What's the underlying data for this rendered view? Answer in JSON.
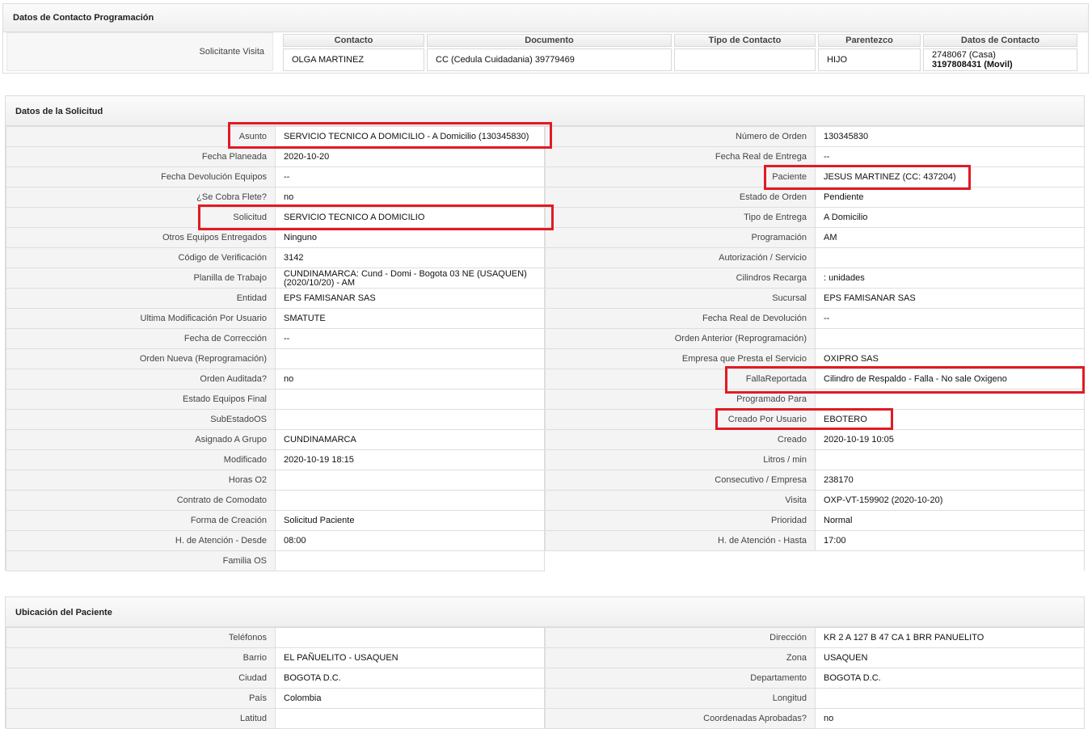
{
  "contact_section": {
    "title": "Datos de Contacto Programación",
    "row_label": "Solicitante Visita",
    "headers": [
      "Contacto",
      "Documento",
      "Tipo de Contacto",
      "Parentezco",
      "Datos de Contacto"
    ],
    "contacto": "OLGA MARTINEZ",
    "documento": "CC (Cedula Cuidadania) 39779469",
    "tipo_contacto": "",
    "parentezco": "HIJO",
    "datos_contacto_line1": "2748067 (Casa)",
    "datos_contacto_line2": "3197808431 (Movil)"
  },
  "solicitud_section": {
    "title": "Datos de la Solicitud",
    "left": [
      {
        "label": "Asunto",
        "value": "SERVICIO TECNICO A DOMICILIO - A Domicilio (130345830)"
      },
      {
        "label": "Fecha Planeada",
        "value": "2020-10-20"
      },
      {
        "label": "Fecha Devolución Equipos",
        "value": "--"
      },
      {
        "label": "¿Se Cobra Flete?",
        "value": "no"
      },
      {
        "label": "Solicitud",
        "value": "SERVICIO TECNICO A DOMICILIO"
      },
      {
        "label": "Otros Equipos Entregados",
        "value": "Ninguno"
      },
      {
        "label": "Código de Verificación",
        "value": "3142"
      },
      {
        "label": "Planilla de Trabajo",
        "value": "CUNDINAMARCA: Cund - Domi - Bogota 03 NE (USAQUEN) (2020/10/20) - AM"
      },
      {
        "label": "Entidad",
        "value": "EPS FAMISANAR SAS"
      },
      {
        "label": "Ultima Modificación Por Usuario",
        "value": "SMATUTE"
      },
      {
        "label": "Fecha de Corrección",
        "value": "--"
      },
      {
        "label": "Orden Nueva (Reprogramación)",
        "value": ""
      },
      {
        "label": "Orden Auditada?",
        "value": "no"
      },
      {
        "label": "Estado Equipos Final",
        "value": ""
      },
      {
        "label": "SubEstadoOS",
        "value": ""
      },
      {
        "label": "Asignado A Grupo",
        "value": "CUNDINAMARCA"
      },
      {
        "label": "Modificado",
        "value": "2020-10-19 18:15"
      },
      {
        "label": "Horas O2",
        "value": ""
      },
      {
        "label": "Contrato de Comodato",
        "value": ""
      },
      {
        "label": "Forma de Creación",
        "value": "Solicitud Paciente"
      },
      {
        "label": "H. de Atención - Desde",
        "value": "08:00"
      },
      {
        "label": "Familia OS",
        "value": ""
      }
    ],
    "right": [
      {
        "label": "Número de Orden",
        "value": "130345830"
      },
      {
        "label": "Fecha Real de Entrega",
        "value": "--"
      },
      {
        "label": "Paciente",
        "value": "JESUS MARTINEZ (CC: 437204)"
      },
      {
        "label": "Estado de Orden",
        "value": "Pendiente"
      },
      {
        "label": "Tipo de Entrega",
        "value": "A Domicilio"
      },
      {
        "label": "Programación",
        "value": "AM"
      },
      {
        "label": "Autorización / Servicio",
        "value": ""
      },
      {
        "label": "Cilindros Recarga",
        "value": ": unidades"
      },
      {
        "label": "Sucursal",
        "value": "EPS FAMISANAR SAS"
      },
      {
        "label": "Fecha Real de Devolución",
        "value": "--"
      },
      {
        "label": "Orden Anterior (Reprogramación)",
        "value": ""
      },
      {
        "label": "Empresa que Presta el Servicio",
        "value": "OXIPRO SAS"
      },
      {
        "label": "FallaReportada",
        "value": "Cilindro de Respaldo - Falla - No sale Oxigeno"
      },
      {
        "label": "Programado Para",
        "value": ""
      },
      {
        "label": "Creado Por Usuario",
        "value": "EBOTERO"
      },
      {
        "label": "Creado",
        "value": "2020-10-19 10:05"
      },
      {
        "label": "Litros / min",
        "value": ""
      },
      {
        "label": "Consecutivo / Empresa",
        "value": "238170"
      },
      {
        "label": "Visita",
        "value": "OXP-VT-159902 (2020-10-20)"
      },
      {
        "label": "Prioridad",
        "value": "Normal"
      },
      {
        "label": "H. de Atención - Hasta",
        "value": "17:00"
      }
    ]
  },
  "ubicacion_section": {
    "title": "Ubicación del Paciente",
    "left": [
      {
        "label": "Teléfonos",
        "value": ""
      },
      {
        "label": "Barrio",
        "value": "EL PAÑUELITO - USAQUEN"
      },
      {
        "label": "Ciudad",
        "value": "BOGOTA D.C."
      },
      {
        "label": "País",
        "value": "Colombia"
      },
      {
        "label": "Latitud",
        "value": ""
      }
    ],
    "right": [
      {
        "label": "Dirección",
        "value": "KR 2 A 127 B 47 CA 1 BRR PANUELITO"
      },
      {
        "label": "Zona",
        "value": "USAQUEN"
      },
      {
        "label": "Departamento",
        "value": "BOGOTA D.C."
      },
      {
        "label": "Longitud",
        "value": ""
      },
      {
        "label": "Coordenadas Aprobadas?",
        "value": "no"
      }
    ]
  },
  "colors": {
    "highlight": "#e01b24",
    "label_bg": "#f4f4f4",
    "border": "#dedede"
  }
}
